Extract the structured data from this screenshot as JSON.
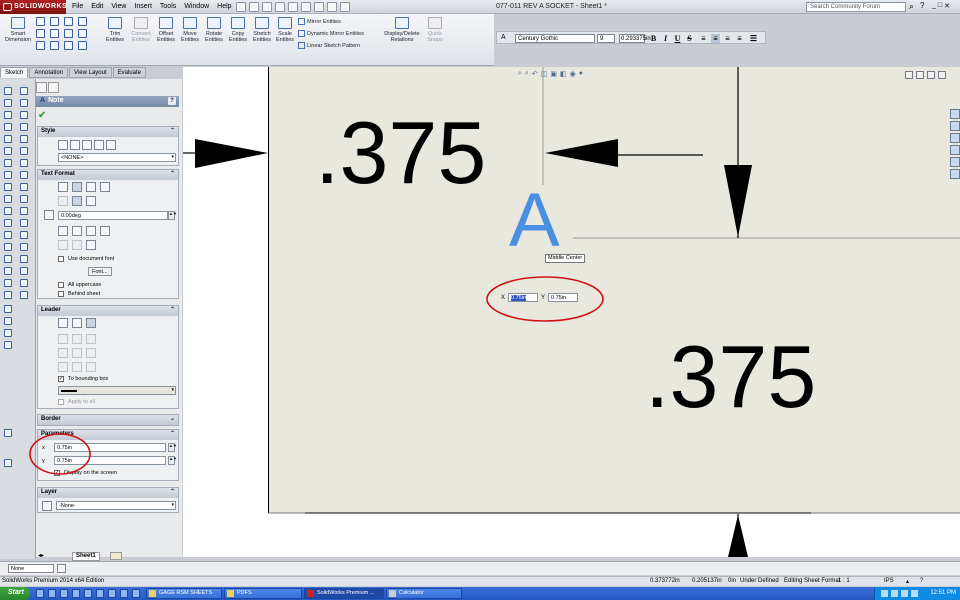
{
  "app": {
    "logo_text": "SOLIDWORKS",
    "menus": [
      "File",
      "Edit",
      "View",
      "Insert",
      "Tools",
      "Window",
      "Help"
    ],
    "document_title": "077-011 REV A SOCKET - Sheet1 *",
    "search_placeholder": "Search Community Forum",
    "window_controls": [
      "_",
      "□",
      "✕"
    ]
  },
  "command_manager": {
    "smart_dimension": "Smart Dimension",
    "trim": "Trim Entities",
    "convert": "Convert Entities",
    "offset": "Offset Entities",
    "move": "Move Entities",
    "rotate": "Rotate Entities",
    "copy": "Copy Entities",
    "stretch": "Stretch Entities",
    "scale": "Scale Entities",
    "mirror": "Mirror Entities",
    "dynamic_mirror": "Dynamic Mirror Entities",
    "linear_pattern": "Linear Sketch Pattern",
    "display_delete": "Display/Delete Relations",
    "quick_snaps": "Quick Snaps",
    "tabs": [
      "Sketch",
      "Annotation",
      "View Layout",
      "Evaluate"
    ]
  },
  "format_toolbar": {
    "font": "Century Gothic",
    "size": "9",
    "height": "0.293375in",
    "buttons": [
      "B",
      "I",
      "U",
      "S"
    ]
  },
  "property_manager": {
    "title": "Note",
    "help": "?",
    "style": {
      "title": "Style",
      "value": "<NONE>"
    },
    "text_format": {
      "title": "Text Format",
      "angle": "0.00deg",
      "use_document_font": "Use document font",
      "font_button": "Font...",
      "all_uppercase": "All uppercase",
      "behind_sheet": "Behind sheet"
    },
    "leader": {
      "title": "Leader",
      "to_bounding_box": "To bounding box",
      "apply_to_all": "Apply to all"
    },
    "border": {
      "title": "Border"
    },
    "parameters": {
      "title": "Parameters",
      "x": "0.75in",
      "y": "0.75in",
      "display_on_screen": "Display on the screen"
    },
    "layer": {
      "title": "Layer",
      "value": "-None-"
    }
  },
  "sheet_tab": "Sheet1",
  "graphics": {
    "dimension_top": ".375",
    "dimension_bottom": ".375",
    "note_letter": "A",
    "anchor_tooltip": "Middle Center",
    "xy_popup": {
      "x_label": "X",
      "x_value": "0.75in",
      "y_label": "Y",
      "y_value": "0.75in"
    }
  },
  "status": {
    "layer": "None",
    "edition": "SolidWorks Premium 2014 x64 Edition",
    "coord_x": "0.373772in",
    "coord_y": "0.205137in",
    "coord_z": "0in",
    "sketch_state": "Under Defined",
    "editing": "Editing Sheet Format",
    "scale": "1 : 1",
    "units": "IPS"
  },
  "taskbar": {
    "start": "Start",
    "items": [
      "GAGE RSM SHEETS",
      "PDFS",
      "SolidWorks Premium ...",
      "Calculator"
    ],
    "clock": "12:51 PM"
  },
  "colors": {
    "note_blue": "#4a90e2",
    "annotation_red": "#d01010",
    "sheet": "#e9e8df"
  }
}
